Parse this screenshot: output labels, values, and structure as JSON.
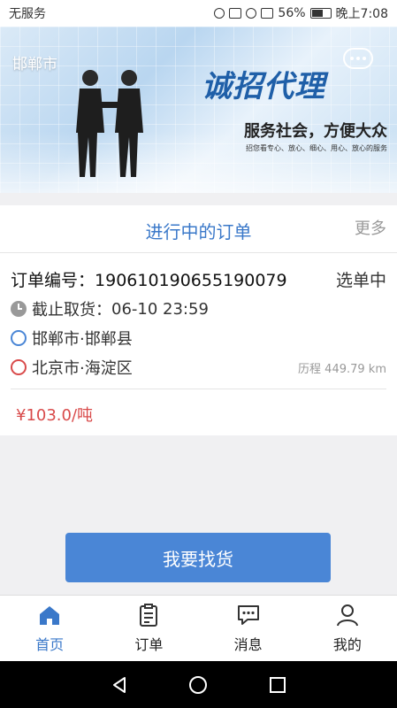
{
  "status_bar": {
    "carrier": "无服务",
    "battery": "56%",
    "time": "晚上7:08"
  },
  "banner": {
    "city": "邯郸市",
    "title": "诚招代理",
    "subtitle": "服务社会，方便大众",
    "tiny_text": "招您看专心、放心、细心、用心、放心的服务",
    "slide_count": 2,
    "active_slide": 1
  },
  "orders_card": {
    "title": "进行中的订单",
    "more_label": "更多",
    "order": {
      "number_label": "订单编号：",
      "number": "190610190655190079",
      "state": "选单中",
      "deadline_label": "截止取货：",
      "deadline": "06-10 23:59",
      "origin": "邯郸市·邯郸县",
      "destination": "北京市·海淀区",
      "distance": "历程 449.79 km",
      "price": "¥103.0/吨"
    }
  },
  "find_goods_button": "我要找货",
  "tabs": [
    {
      "label": "首页",
      "icon": "home-icon",
      "active": true
    },
    {
      "label": "订单",
      "icon": "clipboard-icon",
      "active": false
    },
    {
      "label": "消息",
      "icon": "message-icon",
      "active": false
    },
    {
      "label": "我的",
      "icon": "user-icon",
      "active": false
    }
  ],
  "colors": {
    "accent": "#4a86d6",
    "title_blue": "#3a78c9",
    "price_red": "#d94b4b"
  }
}
